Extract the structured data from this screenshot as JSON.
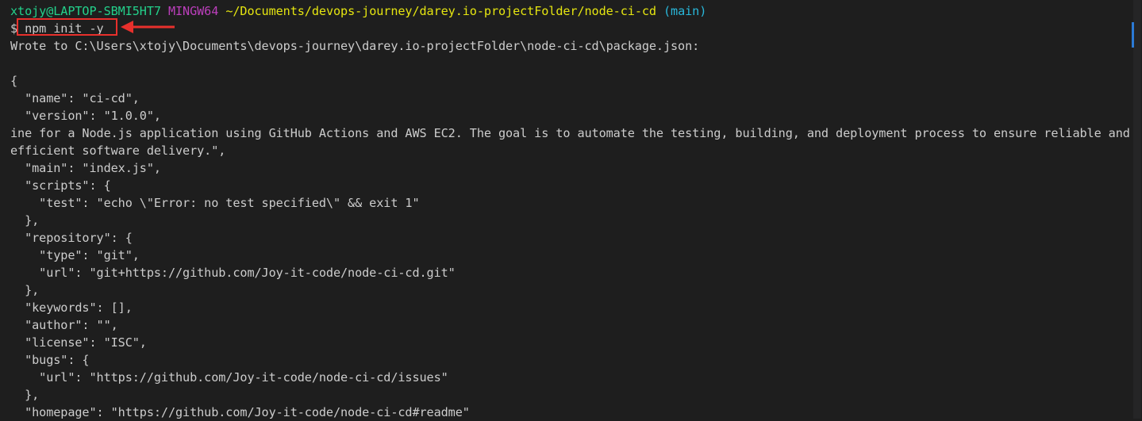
{
  "prompt": {
    "user": "xtojy@LAPTOP-SBMI5HT7",
    "host": "MINGW64",
    "path": "~/Documents/devops-journey/darey.io-projectFolder/node-ci-cd",
    "branch": "(main)"
  },
  "command": {
    "symbol": "$",
    "text": "npm init -y"
  },
  "output": {
    "wrote": "Wrote to C:\\Users\\xtojy\\Documents\\devops-journey\\darey.io-projectFolder\\node-ci-cd\\package.json:",
    "json_lines": [
      "{",
      "  \"name\": \"ci-cd\",",
      "  \"version\": \"1.0.0\",",
      "ine for a Node.js application using GitHub Actions and AWS EC2. The goal is to automate the testing, building, and deployment process to ensure reliable and",
      "efficient software delivery.\",",
      "  \"main\": \"index.js\",",
      "  \"scripts\": {",
      "    \"test\": \"echo \\\"Error: no test specified\\\" && exit 1\"",
      "  },",
      "  \"repository\": {",
      "    \"type\": \"git\",",
      "    \"url\": \"git+https://github.com/Joy-it-code/node-ci-cd.git\"",
      "  },",
      "  \"keywords\": [],",
      "  \"author\": \"\",",
      "  \"license\": \"ISC\",",
      "  \"bugs\": {",
      "    \"url\": \"https://github.com/Joy-it-code/node-ci-cd/issues\"",
      "  },",
      "  \"homepage\": \"https://github.com/Joy-it-code/node-ci-cd#readme\""
    ]
  },
  "colors": {
    "background": "#1e1e1e",
    "text": "#cccccc",
    "user": "#23d18b",
    "host": "#bc3fbc",
    "path": "#e5e510",
    "branch": "#29b8db",
    "annotation": "#e8302c"
  }
}
